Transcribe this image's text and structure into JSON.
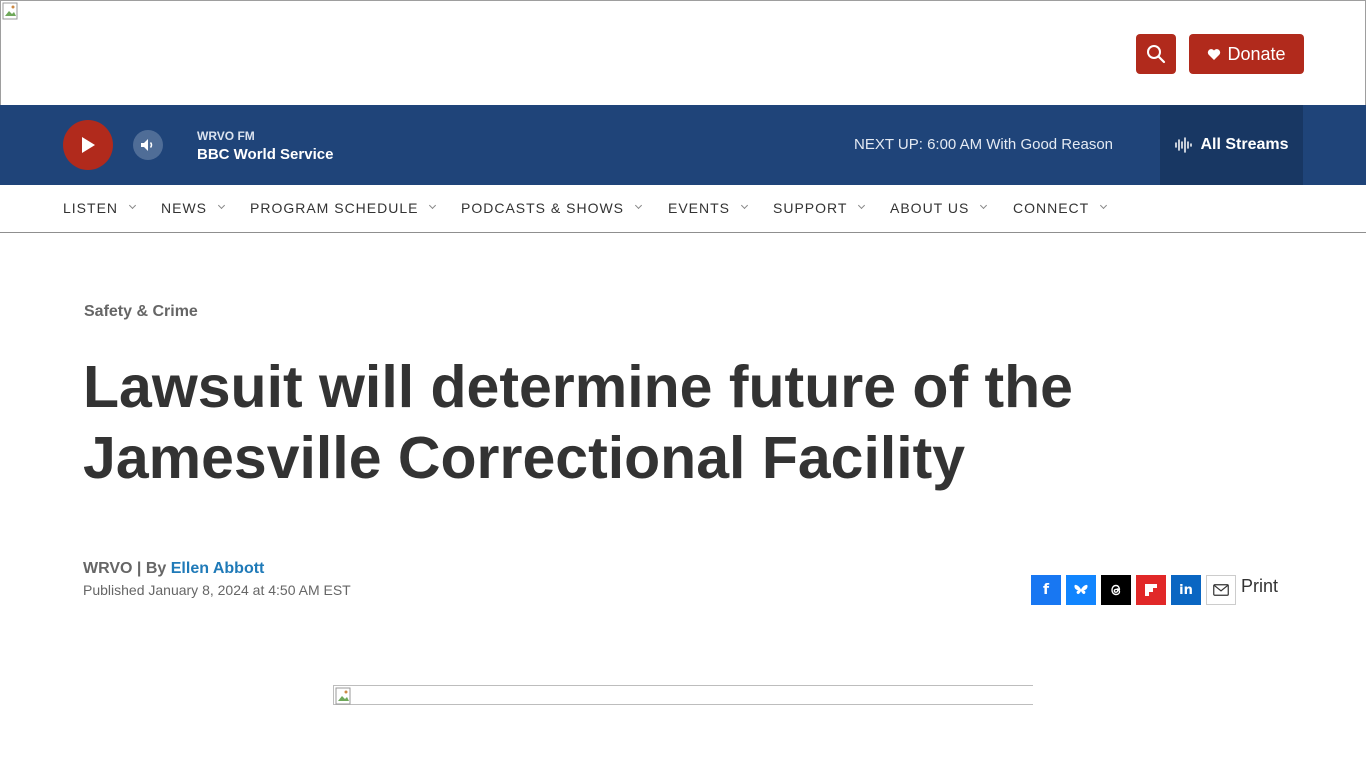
{
  "header": {
    "donate_label": "Donate",
    "colors": {
      "accent": "#b12a1c",
      "player_bg": "#1f4479",
      "streams_bg": "#183763",
      "link": "#1f7ab8"
    }
  },
  "player": {
    "station_call": "WRVO FM",
    "now_playing": "BBC World Service",
    "next_up": "NEXT UP: 6:00 AM With Good Reason",
    "streams_label": "All Streams"
  },
  "nav": {
    "items": [
      {
        "label": "LISTEN"
      },
      {
        "label": "NEWS"
      },
      {
        "label": "PROGRAM SCHEDULE"
      },
      {
        "label": "PODCASTS & SHOWS"
      },
      {
        "label": "EVENTS"
      },
      {
        "label": "SUPPORT"
      },
      {
        "label": "ABOUT US"
      },
      {
        "label": "CONNECT"
      }
    ]
  },
  "article": {
    "category": "Safety & Crime",
    "headline": "Lawsuit will determine future of the Jamesville Correctional Facility",
    "source_by": "WRVO | By ",
    "author": "Ellen Abbott",
    "published": "Published January 8, 2024 at 4:50 AM EST"
  },
  "share": {
    "icons": [
      "facebook-icon",
      "bluesky-icon",
      "threads-icon",
      "flipboard-icon",
      "linkedin-icon",
      "email-icon"
    ],
    "print_label": "Print"
  }
}
